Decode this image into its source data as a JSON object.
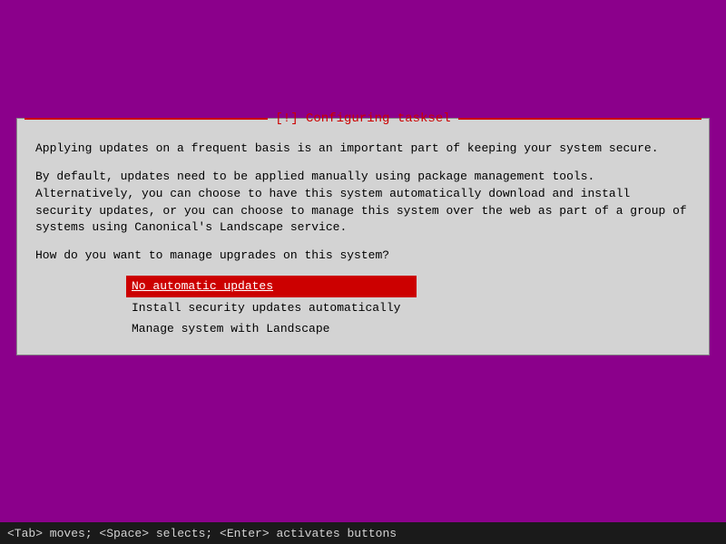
{
  "window": {
    "background_color": "#8b008b"
  },
  "dialog": {
    "title": "[!] Configuring tasksel",
    "title_color": "#cc0000",
    "paragraphs": [
      "Applying updates on a frequent basis is an important part of keeping your system secure.",
      "By default, updates need to be applied manually using package management tools.\nAlternatively, you can choose to have this system automatically download and install\nsecurity updates, or you can choose to manage this system over the web as part of a group\nof systems using Canonical's Landscape service.",
      "How do you want to manage upgrades on this system?"
    ],
    "options": [
      {
        "label": "No automatic updates",
        "selected": true
      },
      {
        "label": "Install security updates automatically",
        "selected": false
      },
      {
        "label": "Manage system with Landscape",
        "selected": false
      }
    ]
  },
  "status_bar": {
    "text": "<Tab> moves; <Space> selects; <Enter> activates buttons"
  }
}
